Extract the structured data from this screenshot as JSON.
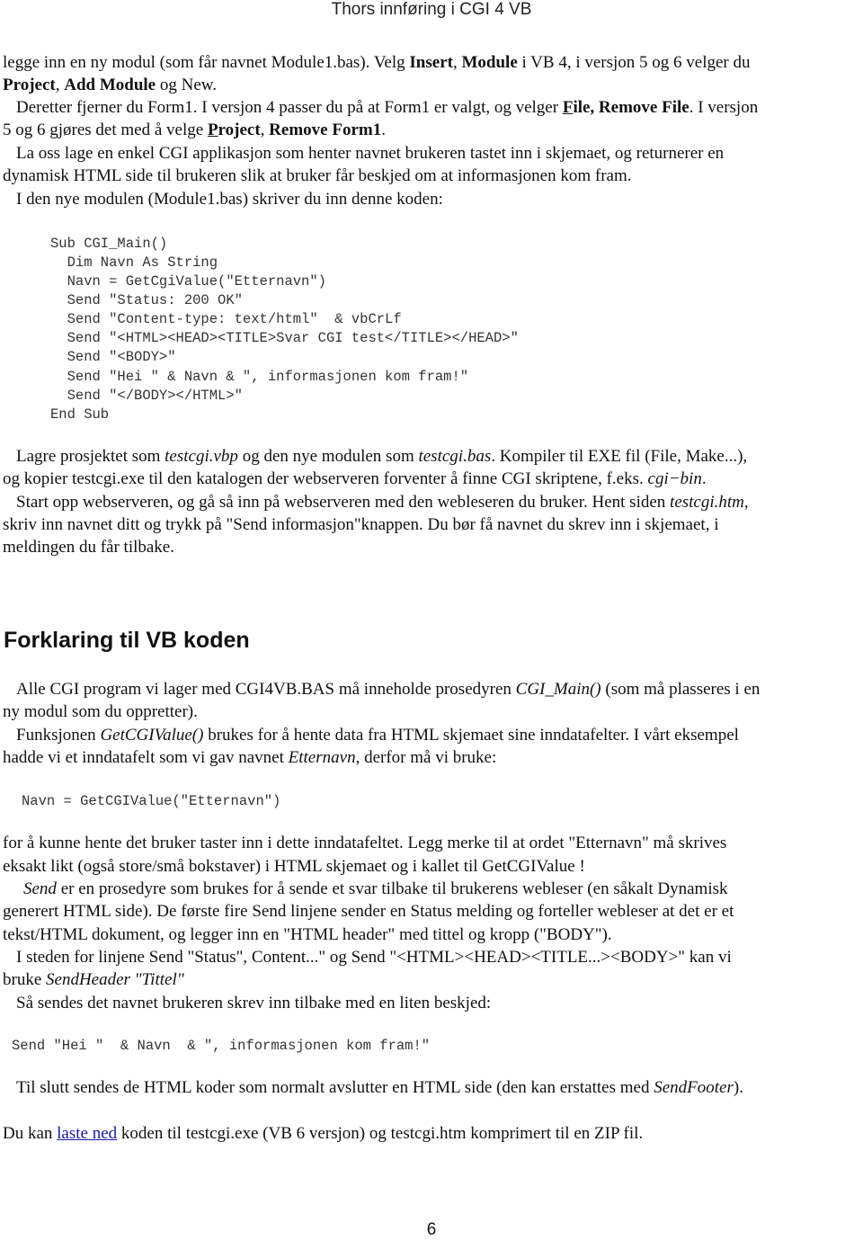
{
  "header": {
    "title": "Thors innføring i CGI 4 VB"
  },
  "intro": {
    "l1_a": "legge inn en ny modul (som får  navnet Module1.bas). Velg ",
    "l1_b1": "Insert",
    "l1_sep": ", ",
    "l1_b2": "Module",
    "l1_c": " i VB 4, i  versjon 5 og 6 velger du",
    "l2_b1": "Project",
    "l2_sep": ", ",
    "l2_b2": "Add Module",
    "l2_c": " og New.",
    "l3_a": "Deretter fjerner du Form1. I versjon 4 passer du på at Form1 er  valgt, og velger  ",
    "l3_u": "F",
    "l3_b": "ile, Remove File",
    "l3_c": ". I  versjon",
    "l4_a": "5 og 6 gjøres det med å velge ",
    "l4_u": "P",
    "l4_b1": "roject",
    "l4_sep": ",  ",
    "l4_b2": "Remove Form1",
    "l4_c": ".",
    "l5": "La oss lage en enkel CGI applikasjon som henter navnet  brukeren tastet inn i skjemaet, og returnerer en",
    "l6": "dynamisk  HTML side til brukeren slik at bruker får beskjed  om at informasjonen kom fram.",
    "l7": "I den nye modulen (Module1.bas) skriver du inn denne koden:"
  },
  "code_block": {
    "lines": [
      "Sub CGI_Main()",
      "  Dim Navn As String",
      "  Navn = GetCgiValue(\"Etternavn\")",
      "  Send \"Status: 200 OK\"",
      "  Send \"Content-type: text/html\"  & vbCrLf",
      "  Send \"<HTML><HEAD><TITLE>Svar CGI test</TITLE></HEAD>\"",
      "  Send \"<BODY>\"",
      "  Send \"Hei \" & Navn & \", informasjonen kom fram!\"",
      "  Send \"</BODY></HTML>\"",
      "End Sub"
    ]
  },
  "after_code": {
    "p1_a": "Lagre prosjektet som ",
    "p1_i1": "testcgi.vbp",
    "p1_b": " og den nye modulen som  ",
    "p1_i2": "testcgi.bas",
    "p1_c": ". Kompiler til EXE fil (File, Make...),",
    "p2_a": "og kopier testcgi.exe  til den katalogen der webserveren forventer å finne CGI skriptene,  f.eks. ",
    "p2_i": "cgi−bin",
    "p2_c": ".",
    "p3_a": "Start opp webserveren, og gå så inn på webserveren  med den webleseren du bruker. Hent siden ",
    "p3_i": "testcgi.htm",
    "p3_c": ",",
    "p4": "skriv inn navnet ditt og trykk på \"Send informasjon\"knappen.  Du bør få navnet du skrev inn i skjemaet, i",
    "p5": "meldingen du  får tilbake."
  },
  "section": {
    "heading": "Forklaring til VB koden",
    "s1_a": "Alle CGI program vi lager med CGI4VB.BAS må  inneholde prosedyren ",
    "s1_i": "CGI_Main()",
    "s1_c": " (som må plasseres  i en",
    "s2": "ny modul som du oppretter).",
    "s3_a": "Funksjonen ",
    "s3_i": "GetCGIValue()",
    "s3_c": " brukes for å hente  data fra HTML skjemaet sine inndatafelter. I vårt  eksempel",
    "s4_a": "hadde vi et inndatafelt som vi gav navnet  ",
    "s4_i": "Etternavn",
    "s4_c": ", derfor må vi bruke:",
    "code1": "Navn = GetCGIValue(\"Etternavn\")",
    "s5": "for å  kunne hente det bruker taster inn i dette inndatafeltet.  Legg merke til at ordet \"Etternavn\" må skrives",
    "s6": "eksakt  likt (også store/små bokstaver) i HTML skjemaet og i  kallet til GetCGIValue !",
    "s7_i": "Send",
    "s7_c": " er en prosedyre som brukes for å sende et  svar tilbake til brukerens webleser (en såkalt  Dynamisk",
    "s8": "generert HTML side). De første fire Send linjene sender  en Status melding og forteller webleser at det er et",
    "s9": "tekst/HTML dokument, og legger inn en \"HTML header\" med  tittel og kropp (\"BODY\").",
    "s10": "I steden for linjene Send \"Status\", Content...\"  og Send \"<HTML><HEAD><TITLE...><BODY>\"  kan vi",
    "s11_a": "bruke ",
    "s11_i": "SendHeader \"Tittel\"",
    "s12": "Så sendes det navnet brukeren skrev inn tilbake med en liten  beskjed:",
    "code2": "Send \"Hei \"  & Navn  & \", informasjonen kom fram!\"",
    "s13_a": "Til slutt sendes de HTML koder som normalt avslutter en HTML side  (den kan erstattes med ",
    "s13_i": "SendFooter",
    "s13_c": ").",
    "s14_a": "Du kan ",
    "s14_link": "laste ned",
    "s14_c": " koden til testcgi.exe (VB 6 versjon) og testcgi.htm  komprimert til en ZIP fil."
  },
  "footer": {
    "page_number": "6"
  },
  "colors": {
    "link": "#1a1aa6",
    "code_text": "#333333"
  }
}
